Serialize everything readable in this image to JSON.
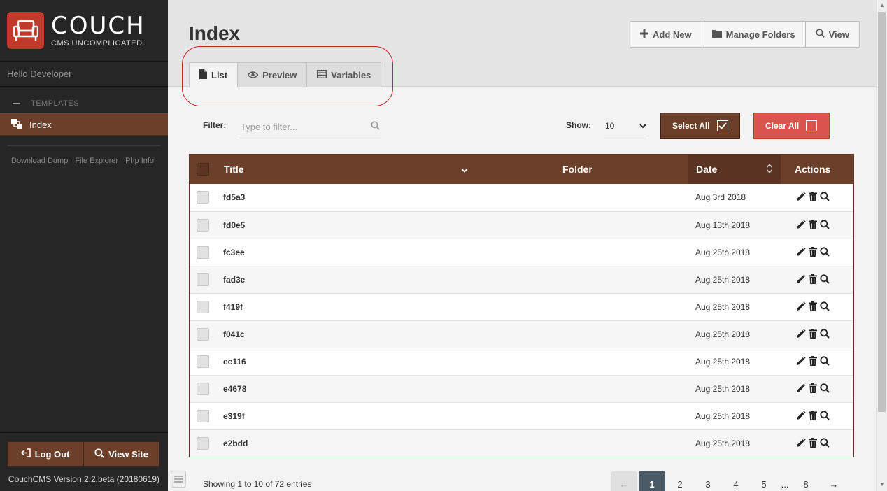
{
  "app": {
    "logo_title": "COUCH",
    "logo_subtitle": "CMS UNCOMPLICATED",
    "greeting": "Hello Developer",
    "version": "CouchCMS Version 2.2.beta (20180619)"
  },
  "sidebar": {
    "section_label": "TEMPLATES",
    "items": [
      {
        "label": "Index",
        "icon": "templates-icon"
      }
    ],
    "links": [
      "Download Dump",
      "File Explorer",
      "Php Info"
    ],
    "logout_label": "Log Out",
    "viewsite_label": "View Site"
  },
  "header": {
    "title": "Index",
    "buttons": [
      {
        "label": "Add New",
        "icon": "plus-icon"
      },
      {
        "label": "Manage Folders",
        "icon": "folder-icon"
      },
      {
        "label": "View",
        "icon": "search-icon"
      }
    ],
    "tabs": [
      {
        "label": "List",
        "icon": "document-icon",
        "active": true
      },
      {
        "label": "Preview",
        "icon": "eye-icon",
        "active": false
      },
      {
        "label": "Variables",
        "icon": "table-icon",
        "active": false
      }
    ]
  },
  "controls": {
    "filter_label": "Filter:",
    "filter_placeholder": "Type to filter...",
    "show_label": "Show:",
    "show_value": "10",
    "select_all_label": "Select All",
    "clear_all_label": "Clear All"
  },
  "table": {
    "columns": [
      "Title",
      "Folder",
      "Date",
      "Actions"
    ],
    "rows": [
      {
        "title": "fd5a3",
        "folder": "",
        "date": "Aug 3rd 2018"
      },
      {
        "title": "fd0e5",
        "folder": "",
        "date": "Aug 13th 2018"
      },
      {
        "title": "fc3ee",
        "folder": "",
        "date": "Aug 25th 2018"
      },
      {
        "title": "fad3e",
        "folder": "",
        "date": "Aug 25th 2018"
      },
      {
        "title": "f419f",
        "folder": "",
        "date": "Aug 25th 2018"
      },
      {
        "title": "f041c",
        "folder": "",
        "date": "Aug 25th 2018"
      },
      {
        "title": "ec116",
        "folder": "",
        "date": "Aug 25th 2018"
      },
      {
        "title": "e4678",
        "folder": "",
        "date": "Aug 25th 2018"
      },
      {
        "title": "e319f",
        "folder": "",
        "date": "Aug 25th 2018"
      },
      {
        "title": "e2bdd",
        "folder": "",
        "date": "Aug 25th 2018"
      }
    ]
  },
  "footer": {
    "entries_text": "Showing 1 to 10 of 72 entries",
    "pages": [
      "←",
      "1",
      "2",
      "3",
      "4",
      "5",
      "...",
      "8",
      "→"
    ],
    "current_page": "1"
  },
  "colors": {
    "brand_brown": "#6b3f2a",
    "danger_red": "#d9534f",
    "sidebar_bg": "#262626",
    "annotation_red": "#d0202a"
  }
}
